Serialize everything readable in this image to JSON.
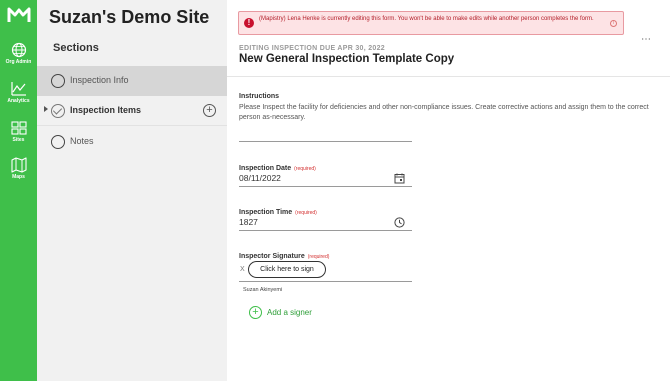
{
  "nav": {
    "items": [
      {
        "label": "Org Admin",
        "icon": "globe-icon"
      },
      {
        "label": "Analytics",
        "icon": "chart-line-icon"
      },
      {
        "label": "Sites",
        "icon": "sites-grid-icon"
      },
      {
        "label": "Maps",
        "icon": "map-icon"
      }
    ],
    "brand_color": "#3fbf4a"
  },
  "sidebar": {
    "site_title": "Suzan's Demo Site",
    "heading": "Sections",
    "items": [
      {
        "label": "Inspection Info",
        "state": "active"
      },
      {
        "label": "Inspection Items",
        "state": "completed"
      },
      {
        "label": "Notes",
        "state": "default"
      }
    ]
  },
  "banner": {
    "message": "(Mapistry) Lena Henke is currently editing this form. You won't be able to make edits while another person completes the form.",
    "color": "#b3202b"
  },
  "header": {
    "due": "EDITING INSPECTION DUE APR 30, 2022",
    "title": "New General Inspection Template Copy",
    "more": "⋯"
  },
  "form": {
    "instructions_label": "Instructions",
    "instructions_text": "Please Inspect the facility for deficiencies and other non-compliance issues. Create corrective actions and assign them to the correct person as-necessary.",
    "required_text": "(required)",
    "date_label": "Inspection Date",
    "date_value": "08/11/2022",
    "time_label": "Inspection Time",
    "time_value": "1827",
    "signature_label": "Inspector Signature",
    "sign_x": "X",
    "sign_button": "Click here to sign",
    "signer_name": "Suzan Akinyemi",
    "add_signer": "Add a signer"
  }
}
